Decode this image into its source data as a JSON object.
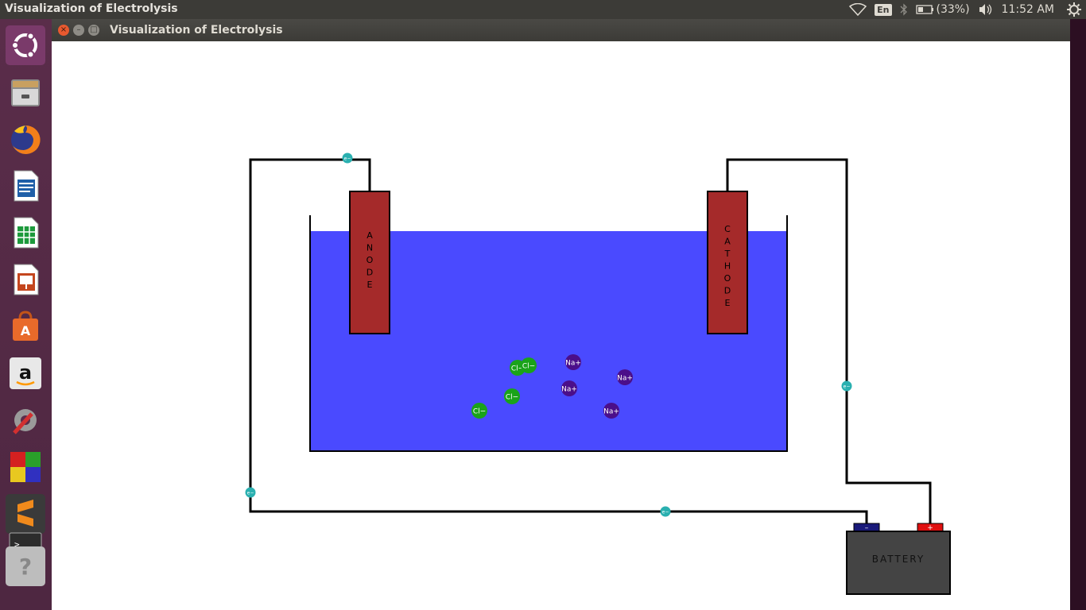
{
  "top_panel": {
    "title": "Visualization of Electrolysis",
    "keyboard": "En",
    "battery": "(33%)",
    "clock": "11:52 AM",
    "icons": [
      "wifi-icon",
      "bluetooth-icon",
      "battery-icon",
      "volume-icon",
      "settings-gear-icon"
    ]
  },
  "launcher": {
    "items": [
      {
        "name": "ubuntu-dash",
        "icon": "ubuntu-logo-icon"
      },
      {
        "name": "files",
        "icon": "file-cabinet-icon"
      },
      {
        "name": "firefox",
        "icon": "firefox-icon"
      },
      {
        "name": "writer",
        "icon": "writer-document-icon"
      },
      {
        "name": "calc",
        "icon": "calc-spreadsheet-icon"
      },
      {
        "name": "impress",
        "icon": "impress-presentation-icon"
      },
      {
        "name": "software-center",
        "icon": "software-bag-icon"
      },
      {
        "name": "amazon",
        "icon": "amazon-icon"
      },
      {
        "name": "system-settings",
        "icon": "settings-wrench-icon"
      },
      {
        "name": "game",
        "icon": "colored-blocks-icon"
      },
      {
        "name": "sublime",
        "icon": "sublime-text-icon"
      },
      {
        "name": "terminal",
        "icon": "terminal-icon"
      },
      {
        "name": "help",
        "icon": "help-question-icon"
      }
    ]
  },
  "window": {
    "title": "Visualization of Electrolysis",
    "close": "×",
    "minimize": "–",
    "maximize": "□"
  },
  "sim": {
    "anode_label": "ANODE",
    "cathode_label": "CATHODE",
    "battery_label": "BATTERY",
    "battery_neg": "–",
    "battery_pos": "+",
    "electron_label": "e−",
    "colors": {
      "solution": "#4a4aff",
      "electrode": "#a52a2a",
      "chloride": "#1aa31a",
      "sodium": "#4b0f8a",
      "electron": "#2ab0b0",
      "battery": "#444444",
      "neg_terminal": "#1a1a7a",
      "pos_terminal": "#e01010",
      "wire": "#000000"
    },
    "ions": [
      {
        "label": "Cl−",
        "type": "chloride"
      },
      {
        "label": "Cl−",
        "type": "chloride"
      },
      {
        "label": "Cl−",
        "type": "chloride"
      },
      {
        "label": "Cl−",
        "type": "chloride"
      },
      {
        "label": "Na+",
        "type": "sodium"
      },
      {
        "label": "Na+",
        "type": "sodium"
      },
      {
        "label": "Na+",
        "type": "sodium"
      },
      {
        "label": "Na+",
        "type": "sodium"
      }
    ],
    "electrons": 4
  }
}
